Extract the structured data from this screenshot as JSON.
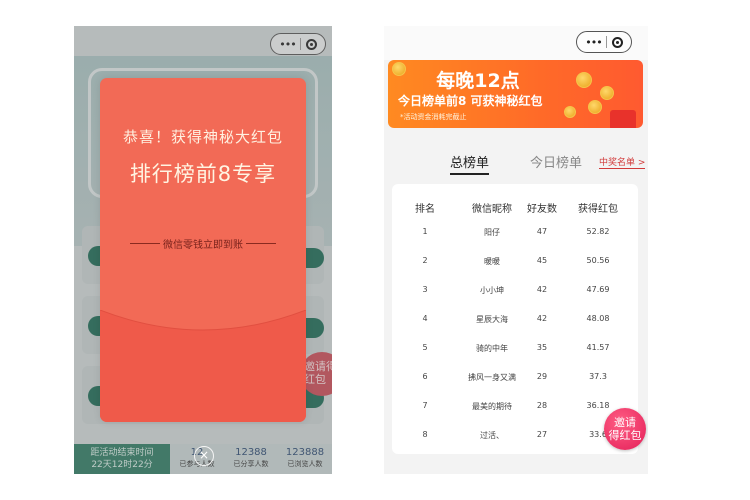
{
  "left": {
    "stats_bottom": {
      "countdown_label": "距活动结束时间",
      "countdown_value": "22天12时22分",
      "stats": [
        {
          "value": "12",
          "label": "已参与人数"
        },
        {
          "value": "12388",
          "label": "已分享人数"
        },
        {
          "value": "123888",
          "label": "已浏览人数"
        }
      ]
    },
    "invite_bg_text": "邀请得红包",
    "popup": {
      "title": "恭喜！获得神秘大红包",
      "subtitle": "排行榜前8专享",
      "tip": "微信零钱立即到账",
      "close_glyph": "×"
    }
  },
  "right": {
    "banner": {
      "title": "每晚12点",
      "subtitle": "今日榜单前8 可获神秘红包",
      "note": "*活动资金消耗完截止"
    },
    "tabs": [
      "总榜单",
      "今日榜单"
    ],
    "winners_link": "中奖名单",
    "winners_chevron": ">",
    "table": {
      "headers": [
        "排名",
        "微信昵称",
        "好友数",
        "获得红包"
      ],
      "rows": [
        [
          "1",
          "阳仔",
          "47",
          "52.82"
        ],
        [
          "2",
          "暖暖",
          "45",
          "50.56"
        ],
        [
          "3",
          "小小坤",
          "42",
          "47.69"
        ],
        [
          "4",
          "星辰大海",
          "42",
          "48.08"
        ],
        [
          "5",
          "骑的中年",
          "35",
          "41.57"
        ],
        [
          "6",
          "拂风一身又满",
          "29",
          "37.3"
        ],
        [
          "7",
          "最美的期待",
          "28",
          "36.18"
        ],
        [
          "8",
          "过活、",
          "27",
          "33.6"
        ]
      ]
    },
    "invite_button": {
      "line1": "邀请",
      "line2": "得红包"
    }
  },
  "capsule": {
    "dots": "•••"
  },
  "colors": {
    "popup_red": "#f26a56",
    "banner_orange": "#ff7a25",
    "invite_pink": "#e31e58",
    "theme_green": "#2f7a63"
  }
}
